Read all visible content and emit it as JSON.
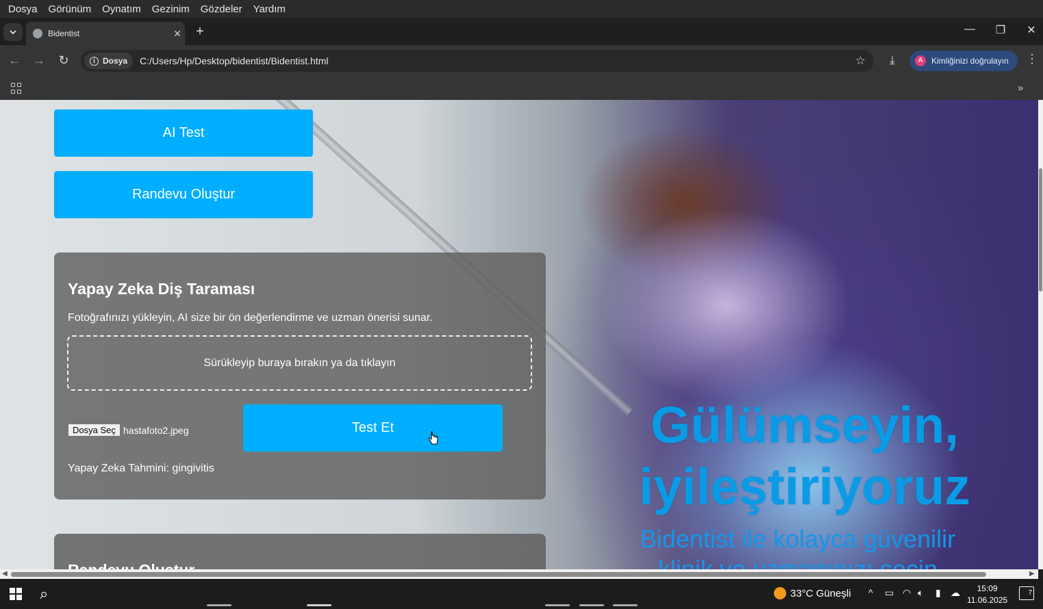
{
  "menubar": {
    "items": [
      "Dosya",
      "Görünüm",
      "Oynatım",
      "Gezinim",
      "Gözdeler",
      "Yardım"
    ]
  },
  "browser": {
    "tab_title": "Bidentist",
    "address_chip": "Dosya",
    "url": "C:/Users/Hp/Desktop/bidentist/Bidentist.html",
    "profile_label": "Kimliğinizi doğrulayın",
    "profile_initial": "A"
  },
  "page": {
    "ai_test_button": "AI Test",
    "appointment_button": "Randevu Oluştur",
    "scan_card": {
      "title": "Yapay Zeka Diş Taraması",
      "description": "Fotoğrafınızı yükleyin, AI size bir ön değerlendirme ve uzman önerisi sunar.",
      "dropzone_text": "Sürükleyip buraya bırakın ya da tıklayın",
      "file_button": "Dosya Seç",
      "file_name": "hastafoto2.jpeg",
      "test_button": "Test Et",
      "prediction": "Yapay Zeka Tahmini: gingivitis"
    },
    "second_card_title": "Randevu Oluştur",
    "hero": {
      "title": "Gülümseyin, iyileştiriyoruz",
      "subtitle": "Bidentist ile kolayca güvenilir klinik ve uzmanınızı seçin"
    }
  },
  "taskbar": {
    "weather": "33°C Güneşli",
    "time": "15:09",
    "date": "11.06.2025",
    "notification_count": "7"
  },
  "colors": {
    "accent_button": "#00aeff",
    "hero_text": "#0a9be6",
    "card_bg": "#5f5f5f"
  }
}
